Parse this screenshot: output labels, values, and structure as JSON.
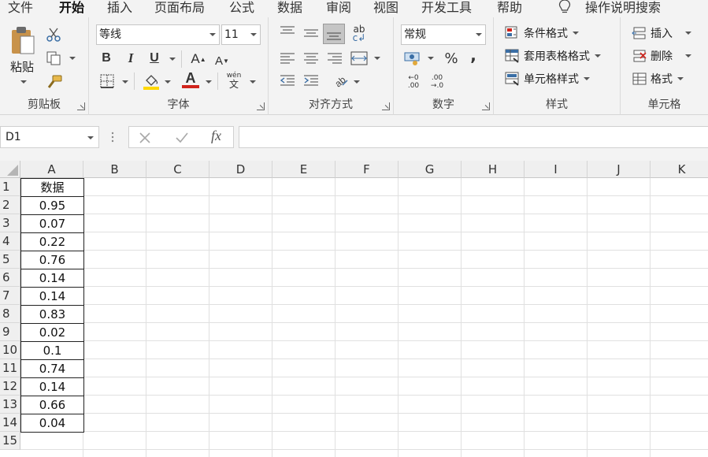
{
  "menu": {
    "tabs": [
      "文件",
      "开始",
      "插入",
      "页面布局",
      "公式",
      "数据",
      "审阅",
      "视图",
      "开发工具",
      "帮助"
    ],
    "active_tab": "开始",
    "search_label": "操作说明搜索"
  },
  "ribbon": {
    "clipboard": {
      "label": "剪贴板",
      "paste_label": "粘贴"
    },
    "font": {
      "label": "字体",
      "font_name": "等线",
      "font_size": "11",
      "bold": "B",
      "italic": "I",
      "underline": "U",
      "grow": "A",
      "shrink": "A",
      "font_color_letter": "A",
      "phonetic_top": "wén",
      "phonetic_bottom": "文",
      "highlight_color": "#ffd800",
      "font_color": "#d0241c"
    },
    "alignment": {
      "label": "对齐方式",
      "wrap_top": "ab",
      "wrap_bottom": "c"
    },
    "number": {
      "label": "数字",
      "format": "常规",
      "percent": "%",
      "comma": ",",
      "inc_decimal_top": "←0",
      "inc_decimal_bottom": ".00",
      "dec_decimal_top": ".00",
      "dec_decimal_bottom": "→.0"
    },
    "styles": {
      "label": "样式",
      "conditional": "条件格式",
      "table": "套用表格格式",
      "cell_styles": "单元格样式"
    },
    "cells": {
      "label": "单元格",
      "insert": "插入",
      "delete": "删除",
      "format": "格式"
    }
  },
  "formula_bar": {
    "name_box": "D1",
    "formula": ""
  },
  "sheet": {
    "columns": [
      "A",
      "B",
      "C",
      "D",
      "E",
      "F",
      "G",
      "H",
      "I",
      "J",
      "K"
    ],
    "rows": [
      "1",
      "2",
      "3",
      "4",
      "5",
      "6",
      "7",
      "8",
      "9",
      "10",
      "11",
      "12",
      "13",
      "14",
      "15"
    ],
    "column_a": [
      "数据",
      "0.95",
      "0.07",
      "0.22",
      "0.76",
      "0.14",
      "0.14",
      "0.83",
      "0.02",
      "0.1",
      "0.74",
      "0.14",
      "0.66",
      "0.04"
    ]
  }
}
